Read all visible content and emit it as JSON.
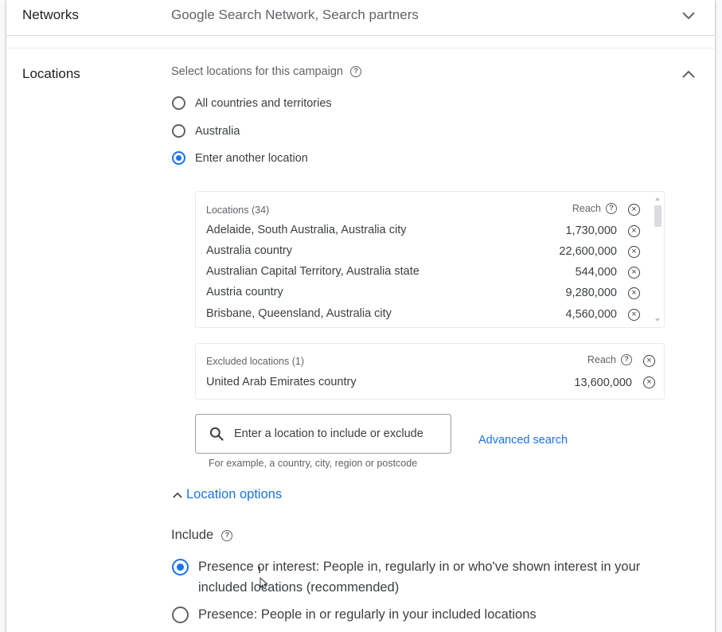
{
  "networks": {
    "label": "Networks",
    "summary": "Google Search Network, Search partners"
  },
  "locations": {
    "label": "Locations",
    "select_title": "Select locations for this campaign",
    "radio_options": [
      {
        "label": "All countries and territories",
        "selected": false
      },
      {
        "label": "Australia",
        "selected": false
      },
      {
        "label": "Enter another location",
        "selected": true
      }
    ],
    "targeted": {
      "header": "Locations (34)",
      "reach_label": "Reach",
      "rows": [
        {
          "name": "Adelaide, South Australia, Australia city",
          "reach": "1,730,000"
        },
        {
          "name": "Australia country",
          "reach": "22,600,000"
        },
        {
          "name": "Australian Capital Territory, Australia state",
          "reach": "544,000"
        },
        {
          "name": "Austria country",
          "reach": "9,280,000"
        },
        {
          "name": "Brisbane, Queensland, Australia city",
          "reach": "4,560,000"
        }
      ]
    },
    "excluded": {
      "header": "Excluded locations (1)",
      "reach_label": "Reach",
      "rows": [
        {
          "name": "United Arab Emirates country",
          "reach": "13,600,000"
        }
      ]
    },
    "search": {
      "placeholder": "Enter a location to include or exclude",
      "hint": "For example, a country, city, region or postcode"
    },
    "advanced_search": "Advanced search",
    "location_options": "Location options",
    "include": {
      "label": "Include",
      "options": [
        {
          "label": "Presence or interest: People in, regularly in or who've shown interest in your included locations (recommended)",
          "selected": true
        },
        {
          "label": "Presence: People in or regularly in your included locations",
          "selected": false
        }
      ]
    }
  },
  "colors": {
    "accent": "#1a73e8",
    "text": "#3c4043",
    "muted": "#5f6368"
  }
}
